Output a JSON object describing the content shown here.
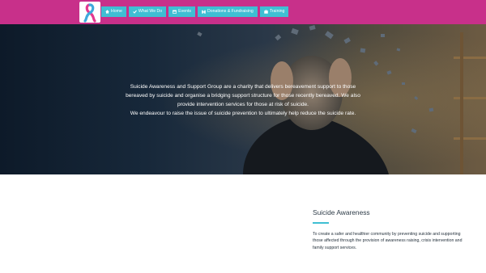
{
  "header": {
    "bg_color": "#c8308a",
    "logo_icon": "awareness-ribbon-icon",
    "nav": [
      {
        "label": "Home",
        "icon": "home-icon"
      },
      {
        "label": "What We Do",
        "icon": "check-icon"
      },
      {
        "label": "Events",
        "icon": "calendar-icon"
      },
      {
        "label": "Donations & Fundraising",
        "icon": "hands-icon"
      },
      {
        "label": "Training",
        "icon": "briefcase-icon"
      }
    ],
    "nav_color": "#3fbfd3"
  },
  "hero": {
    "lines": [
      "Suicide Awareness and Support Group are a charity that delivers bereavement support to those",
      "bereaved by suicide and organise a bridging support structure for those recently bereaved. We also",
      "provide intervention services for those at risk of suicide.",
      "We endeavour to raise the issue of suicide prevention to ultimately help reduce the suicide rate."
    ]
  },
  "aside": {
    "title": "Suicide Awareness",
    "body": "To create a safer and healthier community by preventing suicide and supporting those affected through the provision of awareness raising, crisis intervention and family support services.",
    "accent": "#3fbfd3"
  }
}
